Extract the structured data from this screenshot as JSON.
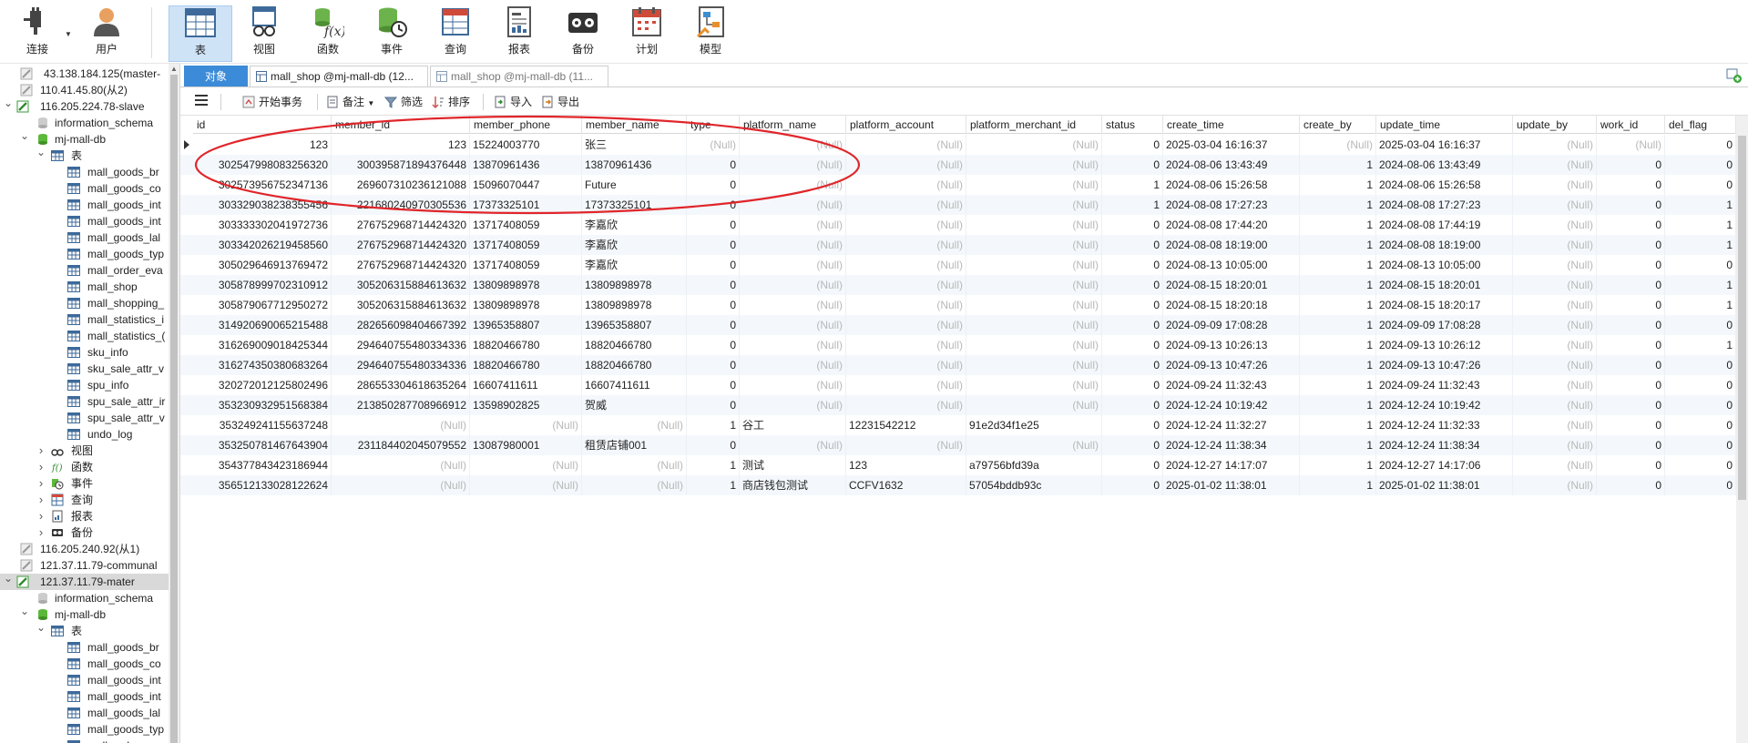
{
  "toolbar": {
    "items": [
      {
        "label": "连接",
        "icon": "plug-icon"
      },
      {
        "label": "用户",
        "icon": "user-icon"
      },
      {
        "label": "表",
        "icon": "table-icon"
      },
      {
        "label": "视图",
        "icon": "view-icon"
      },
      {
        "label": "函数",
        "icon": "function-icon"
      },
      {
        "label": "事件",
        "icon": "event-icon"
      },
      {
        "label": "查询",
        "icon": "query-icon"
      },
      {
        "label": "报表",
        "icon": "report-icon"
      },
      {
        "label": "备份",
        "icon": "backup-icon"
      },
      {
        "label": "计划",
        "icon": "schedule-icon"
      },
      {
        "label": "模型",
        "icon": "model-icon"
      }
    ]
  },
  "sidebar": {
    "items": [
      {
        "text": "43.138.184.125(master-",
        "icon": "server"
      },
      {
        "text": "110.41.45.80(从2)",
        "icon": "server"
      },
      {
        "text": "116.205.224.78-slave",
        "icon": "server-green",
        "arrow": "down"
      },
      {
        "text": "information_schema",
        "icon": "schema"
      },
      {
        "text": "mj-mall-db",
        "icon": "db",
        "arrow": "down"
      },
      {
        "text": "表",
        "icon": "table",
        "arrow": "down"
      },
      {
        "text": "mall_goods_br",
        "icon": "table"
      },
      {
        "text": "mall_goods_co",
        "icon": "table"
      },
      {
        "text": "mall_goods_int",
        "icon": "table"
      },
      {
        "text": "mall_goods_int",
        "icon": "table"
      },
      {
        "text": "mall_goods_lal",
        "icon": "table"
      },
      {
        "text": "mall_goods_typ",
        "icon": "table"
      },
      {
        "text": "mall_order_eva",
        "icon": "table"
      },
      {
        "text": "mall_shop",
        "icon": "table"
      },
      {
        "text": "mall_shopping_",
        "icon": "table"
      },
      {
        "text": "mall_statistics_i",
        "icon": "table"
      },
      {
        "text": "mall_statistics_(",
        "icon": "table"
      },
      {
        "text": "sku_info",
        "icon": "table"
      },
      {
        "text": "sku_sale_attr_v",
        "icon": "table"
      },
      {
        "text": "spu_info",
        "icon": "table"
      },
      {
        "text": "spu_sale_attr_ir",
        "icon": "table"
      },
      {
        "text": "spu_sale_attr_v",
        "icon": "table"
      },
      {
        "text": "undo_log",
        "icon": "table"
      },
      {
        "text": "视图",
        "icon": "view",
        "arrow": "right"
      },
      {
        "text": "函数",
        "icon": "func",
        "arrow": "right"
      },
      {
        "text": "事件",
        "icon": "event",
        "arrow": "right"
      },
      {
        "text": "查询",
        "icon": "query",
        "arrow": "right"
      },
      {
        "text": "报表",
        "icon": "report",
        "arrow": "right"
      },
      {
        "text": "备份",
        "icon": "backup",
        "arrow": "right"
      },
      {
        "text": "116.205.240.92(从1)",
        "icon": "server"
      },
      {
        "text": "121.37.11.79-communal",
        "icon": "server"
      },
      {
        "text": "121.37.11.79-mater",
        "icon": "server-green",
        "arrow": "down",
        "selected": true
      },
      {
        "text": "information_schema",
        "icon": "schema"
      },
      {
        "text": "mj-mall-db",
        "icon": "db",
        "arrow": "down"
      },
      {
        "text": "表",
        "icon": "table",
        "arrow": "down"
      },
      {
        "text": "mall_goods_br",
        "icon": "table"
      },
      {
        "text": "mall_goods_co",
        "icon": "table"
      },
      {
        "text": "mall_goods_int",
        "icon": "table"
      },
      {
        "text": "mall_goods_int",
        "icon": "table"
      },
      {
        "text": "mall_goods_lal",
        "icon": "table"
      },
      {
        "text": "mall_goods_typ",
        "icon": "table"
      },
      {
        "text": "mall_order_eva",
        "icon": "table"
      }
    ]
  },
  "tabs": [
    {
      "label": "对象"
    },
    {
      "label": "mall_shop @mj-mall-db (12..."
    },
    {
      "label": "mall_shop @mj-mall-db (11..."
    }
  ],
  "subtoolbar": {
    "begin_tx": "开始事务",
    "memo": "备注",
    "filter": "筛选",
    "sort": "排序",
    "import": "导入",
    "export": "导出"
  },
  "null_text": "(Null)",
  "grid": {
    "columns": [
      "id",
      "member_id",
      "member_phone",
      "member_name",
      "type",
      "platform_name",
      "platform_account",
      "platform_merchant_id",
      "status",
      "create_time",
      "create_by",
      "update_time",
      "update_by",
      "work_id",
      "del_flag"
    ],
    "rows": [
      [
        "123",
        "123",
        "15224003770",
        "张三",
        null,
        null,
        null,
        null,
        "0",
        "2025-03-04 16:16:37",
        null,
        "2025-03-04 16:16:37",
        null,
        null,
        "0"
      ],
      [
        "302547998083256320",
        "300395871894376448",
        "13870961436",
        "13870961436",
        "0",
        null,
        null,
        null,
        "0",
        "2024-08-06 13:43:49",
        "1",
        "2024-08-06 13:43:49",
        null,
        "0",
        "0"
      ],
      [
        "302573956752347136",
        "269607310236121088",
        "15096070447",
        "Future",
        "0",
        null,
        null,
        null,
        "1",
        "2024-08-06 15:26:58",
        "1",
        "2024-08-06 15:26:58",
        null,
        "0",
        "0"
      ],
      [
        "303329038238355456",
        "221680240970305536",
        "17373325101",
        "17373325101",
        "0",
        null,
        null,
        null,
        "1",
        "2024-08-08 17:27:23",
        "1",
        "2024-08-08 17:27:23",
        null,
        "0",
        "1"
      ],
      [
        "303333302041972736",
        "276752968714424320",
        "13717408059",
        "李嘉欣",
        "0",
        null,
        null,
        null,
        "0",
        "2024-08-08 17:44:20",
        "1",
        "2024-08-08 17:44:19",
        null,
        "0",
        "1"
      ],
      [
        "303342026219458560",
        "276752968714424320",
        "13717408059",
        "李嘉欣",
        "0",
        null,
        null,
        null,
        "0",
        "2024-08-08 18:19:00",
        "1",
        "2024-08-08 18:19:00",
        null,
        "0",
        "1"
      ],
      [
        "305029646913769472",
        "276752968714424320",
        "13717408059",
        "李嘉欣",
        "0",
        null,
        null,
        null,
        "0",
        "2024-08-13 10:05:00",
        "1",
        "2024-08-13 10:05:00",
        null,
        "0",
        "0"
      ],
      [
        "305878999702310912",
        "305206315884613632",
        "13809898978",
        "13809898978",
        "0",
        null,
        null,
        null,
        "0",
        "2024-08-15 18:20:01",
        "1",
        "2024-08-15 18:20:01",
        null,
        "0",
        "1"
      ],
      [
        "305879067712950272",
        "305206315884613632",
        "13809898978",
        "13809898978",
        "0",
        null,
        null,
        null,
        "0",
        "2024-08-15 18:20:18",
        "1",
        "2024-08-15 18:20:17",
        null,
        "0",
        "1"
      ],
      [
        "314920690065215488",
        "282656098404667392",
        "13965358807",
        "13965358807",
        "0",
        null,
        null,
        null,
        "0",
        "2024-09-09 17:08:28",
        "1",
        "2024-09-09 17:08:28",
        null,
        "0",
        "0"
      ],
      [
        "316269009018425344",
        "294640755480334336",
        "18820466780",
        "18820466780",
        "0",
        null,
        null,
        null,
        "0",
        "2024-09-13 10:26:13",
        "1",
        "2024-09-13 10:26:12",
        null,
        "0",
        "1"
      ],
      [
        "316274350380683264",
        "294640755480334336",
        "18820466780",
        "18820466780",
        "0",
        null,
        null,
        null,
        "0",
        "2024-09-13 10:47:26",
        "1",
        "2024-09-13 10:47:26",
        null,
        "0",
        "0"
      ],
      [
        "320272012125802496",
        "286553304618635264",
        "16607411611",
        "16607411611",
        "0",
        null,
        null,
        null,
        "0",
        "2024-09-24 11:32:43",
        "1",
        "2024-09-24 11:32:43",
        null,
        "0",
        "0"
      ],
      [
        "353230932951568384",
        "213850287708966912",
        "13598902825",
        "贺威",
        "0",
        null,
        null,
        null,
        "0",
        "2024-12-24 10:19:42",
        "1",
        "2024-12-24 10:19:42",
        null,
        "0",
        "0"
      ],
      [
        "353249241155637248",
        null,
        null,
        null,
        "1",
        "谷工",
        "12231542212",
        "91e2d34f1e25",
        "0",
        "2024-12-24 11:32:27",
        "1",
        "2024-12-24 11:32:33",
        null,
        "0",
        "0"
      ],
      [
        "353250781467643904",
        "231184402045079552",
        "13087980001",
        "租赁店铺001",
        "0",
        null,
        null,
        null,
        "0",
        "2024-12-24 11:38:34",
        "1",
        "2024-12-24 11:38:34",
        null,
        "0",
        "0"
      ],
      [
        "354377843423186944",
        null,
        null,
        null,
        "1",
        "测试",
        "123",
        "a79756bfd39a",
        "0",
        "2024-12-27 14:17:07",
        "1",
        "2024-12-27 14:17:06",
        null,
        "0",
        "0"
      ],
      [
        "356512133028122624",
        null,
        null,
        null,
        "1",
        "商店钱包测试",
        "CCFV1632",
        "57054bddb93c",
        "0",
        "2025-01-02 11:38:01",
        "1",
        "2025-01-02 11:38:01",
        null,
        "0",
        "0"
      ]
    ]
  },
  "colors": {
    "accent": "#3c8bd8",
    "selected_tab_bg": "#cfe3f7",
    "null_text": "#b8b8b8",
    "annotation": "#e0262b"
  }
}
